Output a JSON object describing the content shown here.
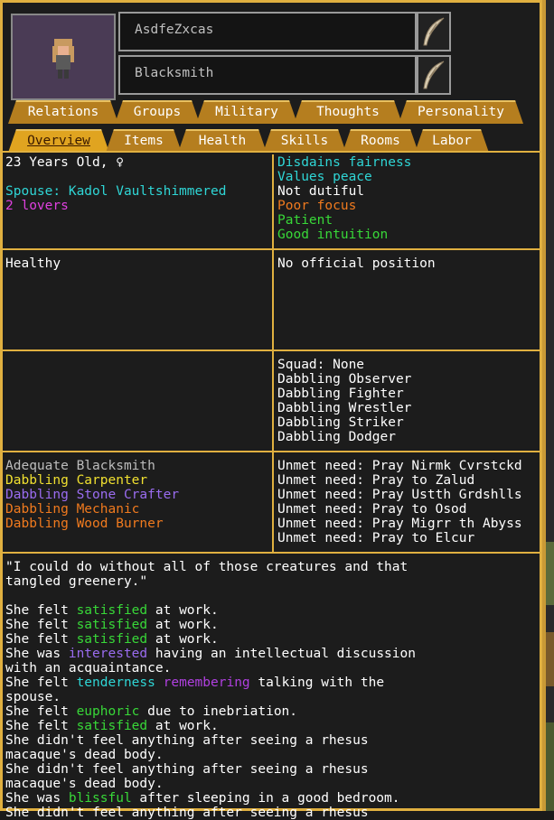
{
  "unit": {
    "name": "AsdfeZxcas",
    "profession": "Blacksmith"
  },
  "icons": {
    "edit": "quill-icon",
    "portrait": "dwarf-portrait"
  },
  "tabs_top": [
    "Relations",
    "Groups",
    "Military",
    "Thoughts",
    "Personality"
  ],
  "tabs_bottom": [
    "Overview",
    "Items",
    "Health",
    "Skills",
    "Rooms",
    "Labor"
  ],
  "active_tab": "Overview",
  "overview": {
    "age": "23 Years Old, ♀",
    "spouse": "Spouse: Kadol Vaultshimmered",
    "lovers": "2 lovers",
    "traits": [
      {
        "text": "Disdains fairness",
        "color": "#2fd6d6"
      },
      {
        "text": "Values peace",
        "color": "#2fd6d6"
      },
      {
        "text": "Not dutiful",
        "color": "#ffffff"
      },
      {
        "text": "Poor focus",
        "color": "#f07a1e"
      },
      {
        "text": "Patient",
        "color": "#38d838"
      },
      {
        "text": "Good intuition",
        "color": "#38d838"
      }
    ],
    "health": "Healthy",
    "position": "No official position",
    "military": [
      "Squad: None",
      "Dabbling Observer",
      "Dabbling Fighter",
      "Dabbling Wrestler",
      "Dabbling Striker",
      "Dabbling Dodger"
    ],
    "skills": [
      {
        "text": "Adequate Blacksmith",
        "color": "#bdbdbd"
      },
      {
        "text": "Dabbling Carpenter",
        "color": "#f0e030"
      },
      {
        "text": "Dabbling Stone Crafter",
        "color": "#9a6cf0"
      },
      {
        "text": "Dabbling Mechanic",
        "color": "#f07a1e"
      },
      {
        "text": "Dabbling Wood Burner",
        "color": "#f07a1e"
      }
    ],
    "needs": [
      "Unmet need: Pray Nirmk Cvrstckd",
      "Unmet need: Pray to Zalud",
      "Unmet need: Pray Ustth Grdshlls",
      "Unmet need: Pray to Osod",
      "Unmet need: Pray Migrr th Abyss",
      "Unmet need: Pray to Elcur"
    ],
    "quote_lines": [
      "\"I could do without all of those creatures and that",
      "tangled greenery.\""
    ],
    "thoughts": [
      [
        {
          "t": "She felt ",
          "c": "#ffffff"
        },
        {
          "t": "satisfied",
          "c": "#38d838"
        },
        {
          "t": " at work.",
          "c": "#ffffff"
        }
      ],
      [
        {
          "t": "She felt ",
          "c": "#ffffff"
        },
        {
          "t": "satisfied",
          "c": "#38d838"
        },
        {
          "t": " at work.",
          "c": "#ffffff"
        }
      ],
      [
        {
          "t": "She felt ",
          "c": "#ffffff"
        },
        {
          "t": "satisfied",
          "c": "#38d838"
        },
        {
          "t": " at work.",
          "c": "#ffffff"
        }
      ],
      [
        {
          "t": "She was ",
          "c": "#ffffff"
        },
        {
          "t": "interested",
          "c": "#9a6cf0"
        },
        {
          "t": " having an intellectual discussion",
          "c": "#ffffff"
        }
      ],
      [
        {
          "t": "with an acquaintance.",
          "c": "#ffffff"
        }
      ],
      [
        {
          "t": "She felt ",
          "c": "#ffffff"
        },
        {
          "t": "tenderness",
          "c": "#2fd6d6"
        },
        {
          "t": " ",
          "c": "#ffffff"
        },
        {
          "t": "remembering",
          "c": "#b040e0"
        },
        {
          "t": " talking with the",
          "c": "#ffffff"
        }
      ],
      [
        {
          "t": "spouse.",
          "c": "#ffffff"
        }
      ],
      [
        {
          "t": "She felt ",
          "c": "#ffffff"
        },
        {
          "t": "euphoric",
          "c": "#38d838"
        },
        {
          "t": " due to inebriation.",
          "c": "#ffffff"
        }
      ],
      [
        {
          "t": "She felt ",
          "c": "#ffffff"
        },
        {
          "t": "satisfied",
          "c": "#38d838"
        },
        {
          "t": " at work.",
          "c": "#ffffff"
        }
      ],
      [
        {
          "t": "She didn't feel anything after seeing a rhesus",
          "c": "#ffffff"
        }
      ],
      [
        {
          "t": "macaque's dead body.",
          "c": "#ffffff"
        }
      ],
      [
        {
          "t": "She didn't feel anything after seeing a rhesus",
          "c": "#ffffff"
        }
      ],
      [
        {
          "t": "macaque's dead body.",
          "c": "#ffffff"
        }
      ],
      [
        {
          "t": "She was ",
          "c": "#ffffff"
        },
        {
          "t": "blissful",
          "c": "#38d838"
        },
        {
          "t": " after sleeping in a good bedroom.",
          "c": "#ffffff"
        }
      ],
      [
        {
          "t": "She didn't feel anything after seeing a rhesus",
          "c": "#ffffff"
        }
      ]
    ]
  }
}
